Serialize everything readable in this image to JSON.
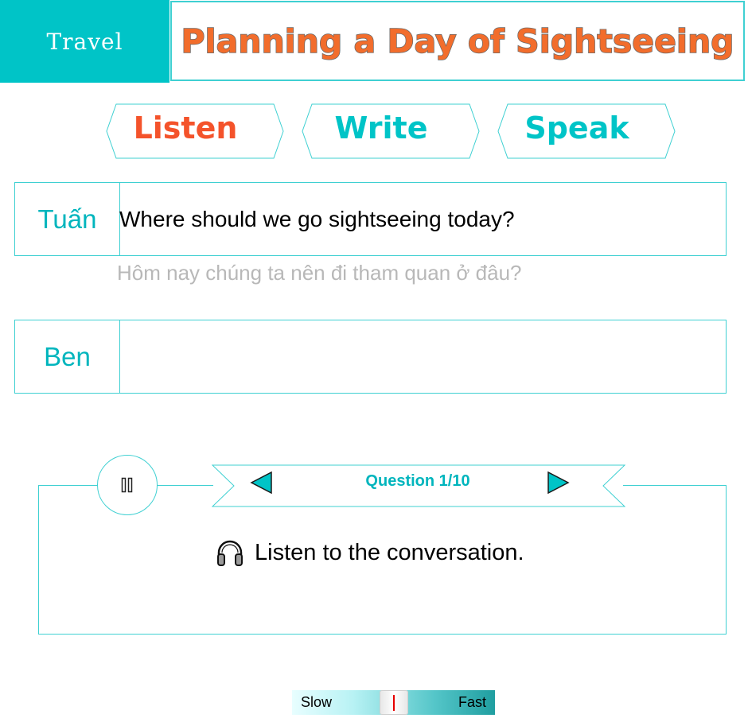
{
  "header": {
    "topic": "Travel",
    "title": "Planning a Day of Sightseeing"
  },
  "modes": [
    {
      "label": "Listen",
      "color": "#f4532b",
      "active": true
    },
    {
      "label": "Write",
      "color": "#00c4c7",
      "active": false
    },
    {
      "label": "Speak",
      "color": "#00c4c7",
      "active": false
    }
  ],
  "dialogue": [
    {
      "speaker": "Tuấn",
      "line": "Where should we go sightseeing today?",
      "translation": "Hôm nay chúng ta nên đi tham quan ở đâu?"
    },
    {
      "speaker": "Ben",
      "line": "",
      "translation": ""
    }
  ],
  "player": {
    "pause_icon": "pause-icon",
    "question_label": "Question 1/10",
    "prev_icon": "triangle-left-icon",
    "next_icon": "triangle-right-icon",
    "instruction": "Listen to the conversation.",
    "instruction_icon": "headphones-icon"
  },
  "speed_control": {
    "slow_label": "Slow",
    "fast_label": "Fast",
    "level": 0.5
  },
  "colors": {
    "accent": "#00c4c7",
    "title": "#f26d2c",
    "active_tab": "#f4532b",
    "border": "#3fd0d2",
    "translation": "#b8b8b8"
  }
}
